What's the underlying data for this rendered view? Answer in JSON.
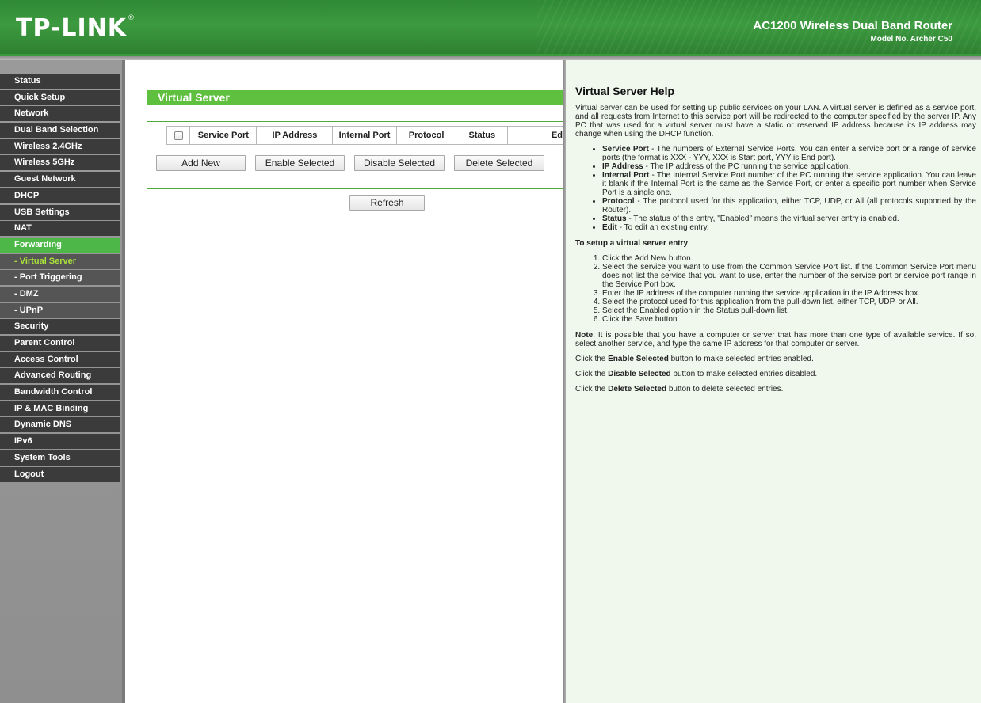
{
  "header": {
    "logo": "TP-LINK",
    "logo_mark": "®",
    "product": "AC1200 Wireless Dual Band Router",
    "model": "Model No. Archer C50"
  },
  "colors": {
    "accent": "#4db848",
    "menu_bg": "#3b3b3b",
    "active_sub_text": "#a9e23a",
    "help_bg": "#f0f7ed"
  },
  "sidebar": {
    "items": [
      {
        "label": "Status"
      },
      {
        "label": "Quick Setup"
      },
      {
        "label": "Network"
      },
      {
        "label": "Dual Band Selection"
      },
      {
        "label": "Wireless 2.4GHz"
      },
      {
        "label": "Wireless 5GHz"
      },
      {
        "label": "Guest Network"
      },
      {
        "label": "DHCP"
      },
      {
        "label": "USB Settings"
      },
      {
        "label": "NAT"
      },
      {
        "label": "Forwarding"
      },
      {
        "label": "- Virtual Server"
      },
      {
        "label": "- Port Triggering"
      },
      {
        "label": "- DMZ"
      },
      {
        "label": "- UPnP"
      },
      {
        "label": "Security"
      },
      {
        "label": "Parent Control"
      },
      {
        "label": "Access Control"
      },
      {
        "label": "Advanced Routing"
      },
      {
        "label": "Bandwidth Control"
      },
      {
        "label": "IP & MAC Binding"
      },
      {
        "label": "Dynamic DNS"
      },
      {
        "label": "IPv6"
      },
      {
        "label": "System Tools"
      },
      {
        "label": "Logout"
      }
    ]
  },
  "main": {
    "title": "Virtual Server",
    "table": {
      "columns": [
        "Service Port",
        "IP Address",
        "Internal Port",
        "Protocol",
        "Status",
        "Ed"
      ]
    },
    "buttons": {
      "add_new": "Add New",
      "enable_selected": "Enable Selected",
      "disable_selected": "Disable Selected",
      "delete_selected": "Delete Selected",
      "refresh": "Refresh"
    }
  },
  "help": {
    "title": "Virtual Server Help",
    "intro": "Virtual server can be used for setting up public services on your LAN. A virtual server is defined as a service port, and all requests from Internet to this service port will be redirected to the computer specified by the server IP. Any PC that was used for a virtual server must have a static or reserved IP address because its IP address may change when using the DHCP function.",
    "fields": [
      {
        "label": "Service Port",
        "text": " - The numbers of External Service Ports. You can enter a service port or a range of service ports (the format is XXX - YYY, XXX is Start port, YYY is End port)."
      },
      {
        "label": "IP Address",
        "text": " - The IP address of the PC running the service application."
      },
      {
        "label": "Internal Port",
        "text": " - The Internal Service Port number of the PC running the service application. You can leave it blank if the Internal Port is the same as the Service Port, or enter a specific port number when Service Port is a single one."
      },
      {
        "label": "Protocol",
        "text": " - The protocol used for this application, either TCP, UDP, or All (all protocols supported by the Router)."
      },
      {
        "label": "Status",
        "text": " - The status of this entry, \"Enabled\" means the virtual server entry is enabled."
      },
      {
        "label": "Edit",
        "text": " - To edit an existing entry."
      }
    ],
    "setup_title": "To setup a virtual server entry",
    "setup_colon": ":",
    "steps": [
      "Click the Add New button.",
      "Select the service you want to use from the Common Service Port list. If the Common Service Port menu does not list the service that you want to use, enter the number of the service port or service port range in the Service Port box.",
      "Enter the IP address of the computer running the service application in the IP Address box.",
      "Select the protocol used for this application from the pull-down list, either TCP, UDP, or All.",
      "Select the Enabled option in the Status pull-down list.",
      "Click the Save button."
    ],
    "note_label": "Note",
    "note_text": ": It is possible that you have a computer or server that has more than one type of available service. If so, select another service, and type the same IP address for that computer or server.",
    "enable_pre": "Click the ",
    "enable_btn": "Enable Selected",
    "enable_post": " button to make selected entries enabled.",
    "disable_pre": "Click the ",
    "disable_btn": "Disable Selected",
    "disable_post": " button to make selected entries disabled.",
    "delete_pre": "Click the ",
    "delete_btn": "Delete Selected",
    "delete_post": " button to delete selected entries."
  }
}
